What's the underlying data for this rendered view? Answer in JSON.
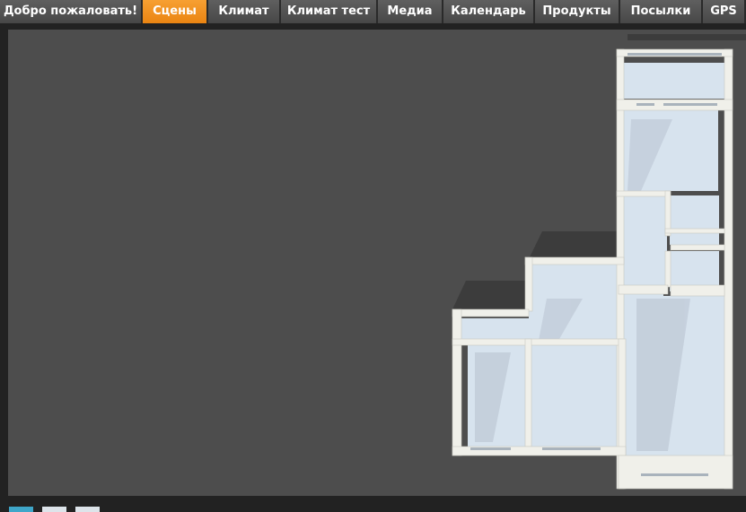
{
  "nav": {
    "tabs": [
      {
        "label": "Добро пожаловать!",
        "active": false
      },
      {
        "label": "Сцены",
        "active": true
      },
      {
        "label": "Климат",
        "active": false
      },
      {
        "label": "Климат тест",
        "active": false
      },
      {
        "label": "Медиа",
        "active": false
      },
      {
        "label": "Календарь",
        "active": false
      },
      {
        "label": "Продукты",
        "active": false
      },
      {
        "label": "Посылки",
        "active": false
      },
      {
        "label": "GPS",
        "active": false
      }
    ]
  },
  "colors": {
    "accent": "#ef8e1f",
    "tab_bg": "#555555",
    "stage_bg": "#4d4d4d",
    "floor": "#d7e3ee",
    "wall": "#f2f2ec"
  },
  "pager": {
    "pages": 3,
    "current": 1
  }
}
